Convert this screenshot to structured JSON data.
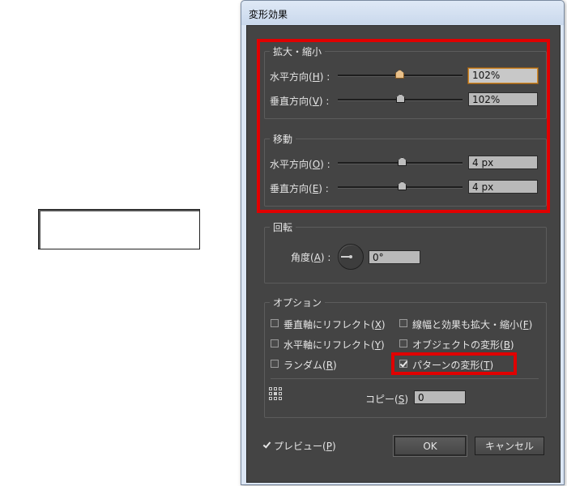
{
  "dialog": {
    "title": "変形効果"
  },
  "scale": {
    "legend": "拡大・縮小",
    "horizontal": {
      "label": "水平方向(",
      "key": "H",
      "tail": ") :",
      "value": "102%"
    },
    "vertical": {
      "label": "垂直方向(",
      "key": "V",
      "tail": ") :",
      "value": "102%"
    }
  },
  "move": {
    "legend": "移動",
    "horizontal": {
      "label": "水平方向(",
      "key": "O",
      "tail": ") :",
      "value": "4 px"
    },
    "vertical": {
      "label": "垂直方向(",
      "key": "E",
      "tail": ") :",
      "value": "4 px"
    }
  },
  "rotate": {
    "legend": "回転",
    "angle": {
      "label": "角度(",
      "key": "A",
      "tail": ") :",
      "value": "0°"
    }
  },
  "options": {
    "legend": "オプション",
    "reflect_vertical": {
      "label": "垂直軸にリフレクト(",
      "key": "X",
      "tail": ")",
      "checked": false
    },
    "reflect_horizontal": {
      "label": "水平軸にリフレクト(",
      "key": "Y",
      "tail": ")",
      "checked": false
    },
    "random": {
      "label": "ランダム(",
      "key": "R",
      "tail": ")",
      "checked": false
    },
    "scale_strokes": {
      "label": "線幅と効果も拡大・縮小(",
      "key": "F",
      "tail": ")",
      "checked": false
    },
    "transform_objects": {
      "label": "オブジェクトの変形(",
      "key": "B",
      "tail": ")",
      "checked": false
    },
    "transform_patterns": {
      "label": "パターンの変形(",
      "key": "T",
      "tail": ")",
      "checked": true
    },
    "copies": {
      "label": "コピー(",
      "key": "S",
      "tail": ")",
      "value": "0"
    }
  },
  "preview": {
    "label": "プレビュー(",
    "key": "P",
    "tail": ")",
    "checked": true
  },
  "buttons": {
    "ok": "OK",
    "cancel": "キャンセル"
  },
  "icons": {
    "reference_point": "reference-point-grid-icon",
    "angle_dial": "angle-dial-icon"
  },
  "colors": {
    "highlight": "#e00000",
    "dialog_bg": "#444444",
    "focus": "#d18b2c"
  }
}
